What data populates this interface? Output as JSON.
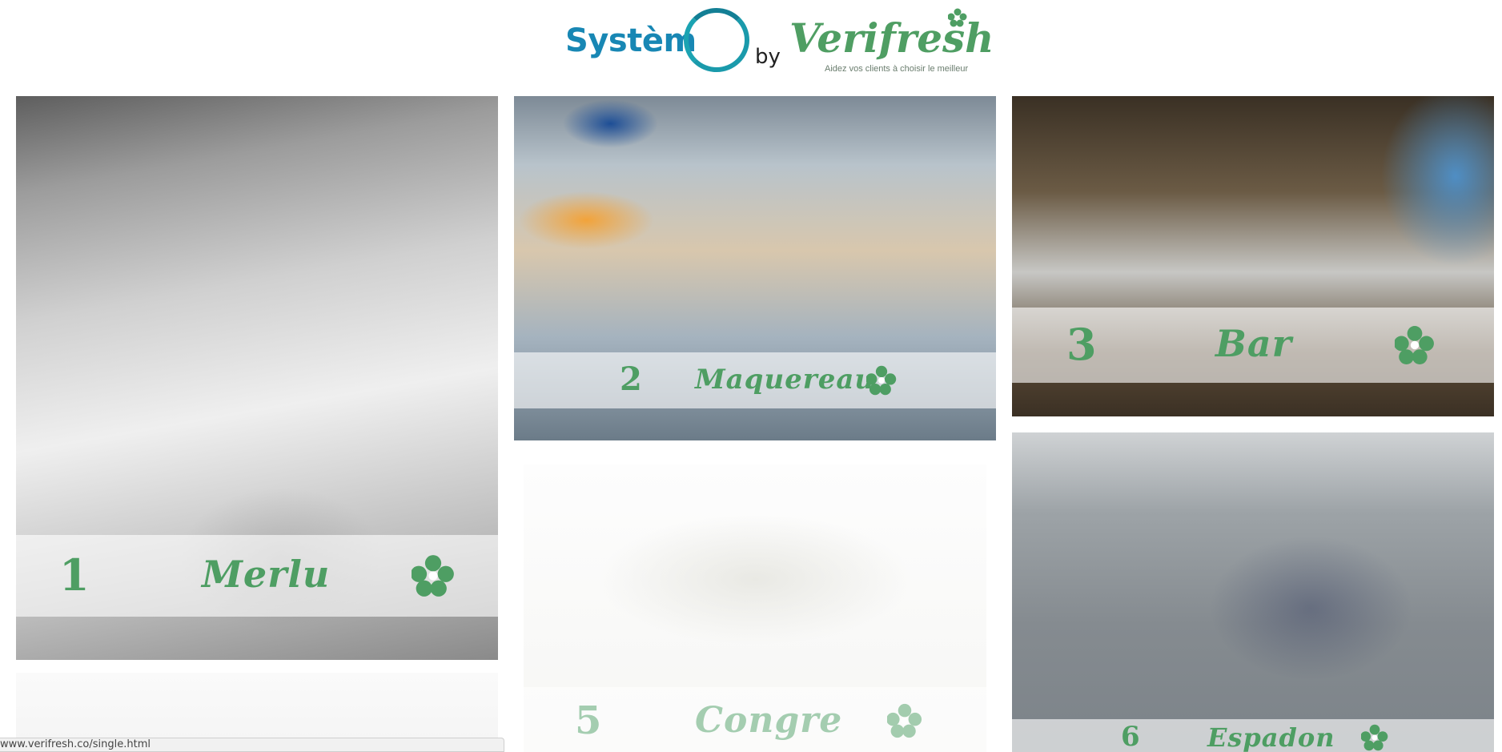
{
  "header": {
    "brand_left": "Systèm",
    "brand_by": "by",
    "brand_right": "Verifresh",
    "tagline": "Aidez vos clients à choisir le meilleur"
  },
  "cards": [
    {
      "number": "1",
      "name": "Merlu"
    },
    {
      "number": "2",
      "name": "Maquereau"
    },
    {
      "number": "3",
      "name": "Bar"
    },
    {
      "number": "5",
      "name": "Congre"
    },
    {
      "number": "6",
      "name": "Espadon"
    }
  ],
  "status_bar": {
    "url": "www.verifresh.co/single.html"
  },
  "colors": {
    "brand_blue": "#1887b4",
    "brand_teal": "#1a9aab",
    "brand_green": "#4e9e63",
    "band_overlay": "rgba(255,255,255,0.62)"
  },
  "icons": {
    "card_badge": "flower-icon",
    "logo_leaf": "leaf-icon"
  }
}
